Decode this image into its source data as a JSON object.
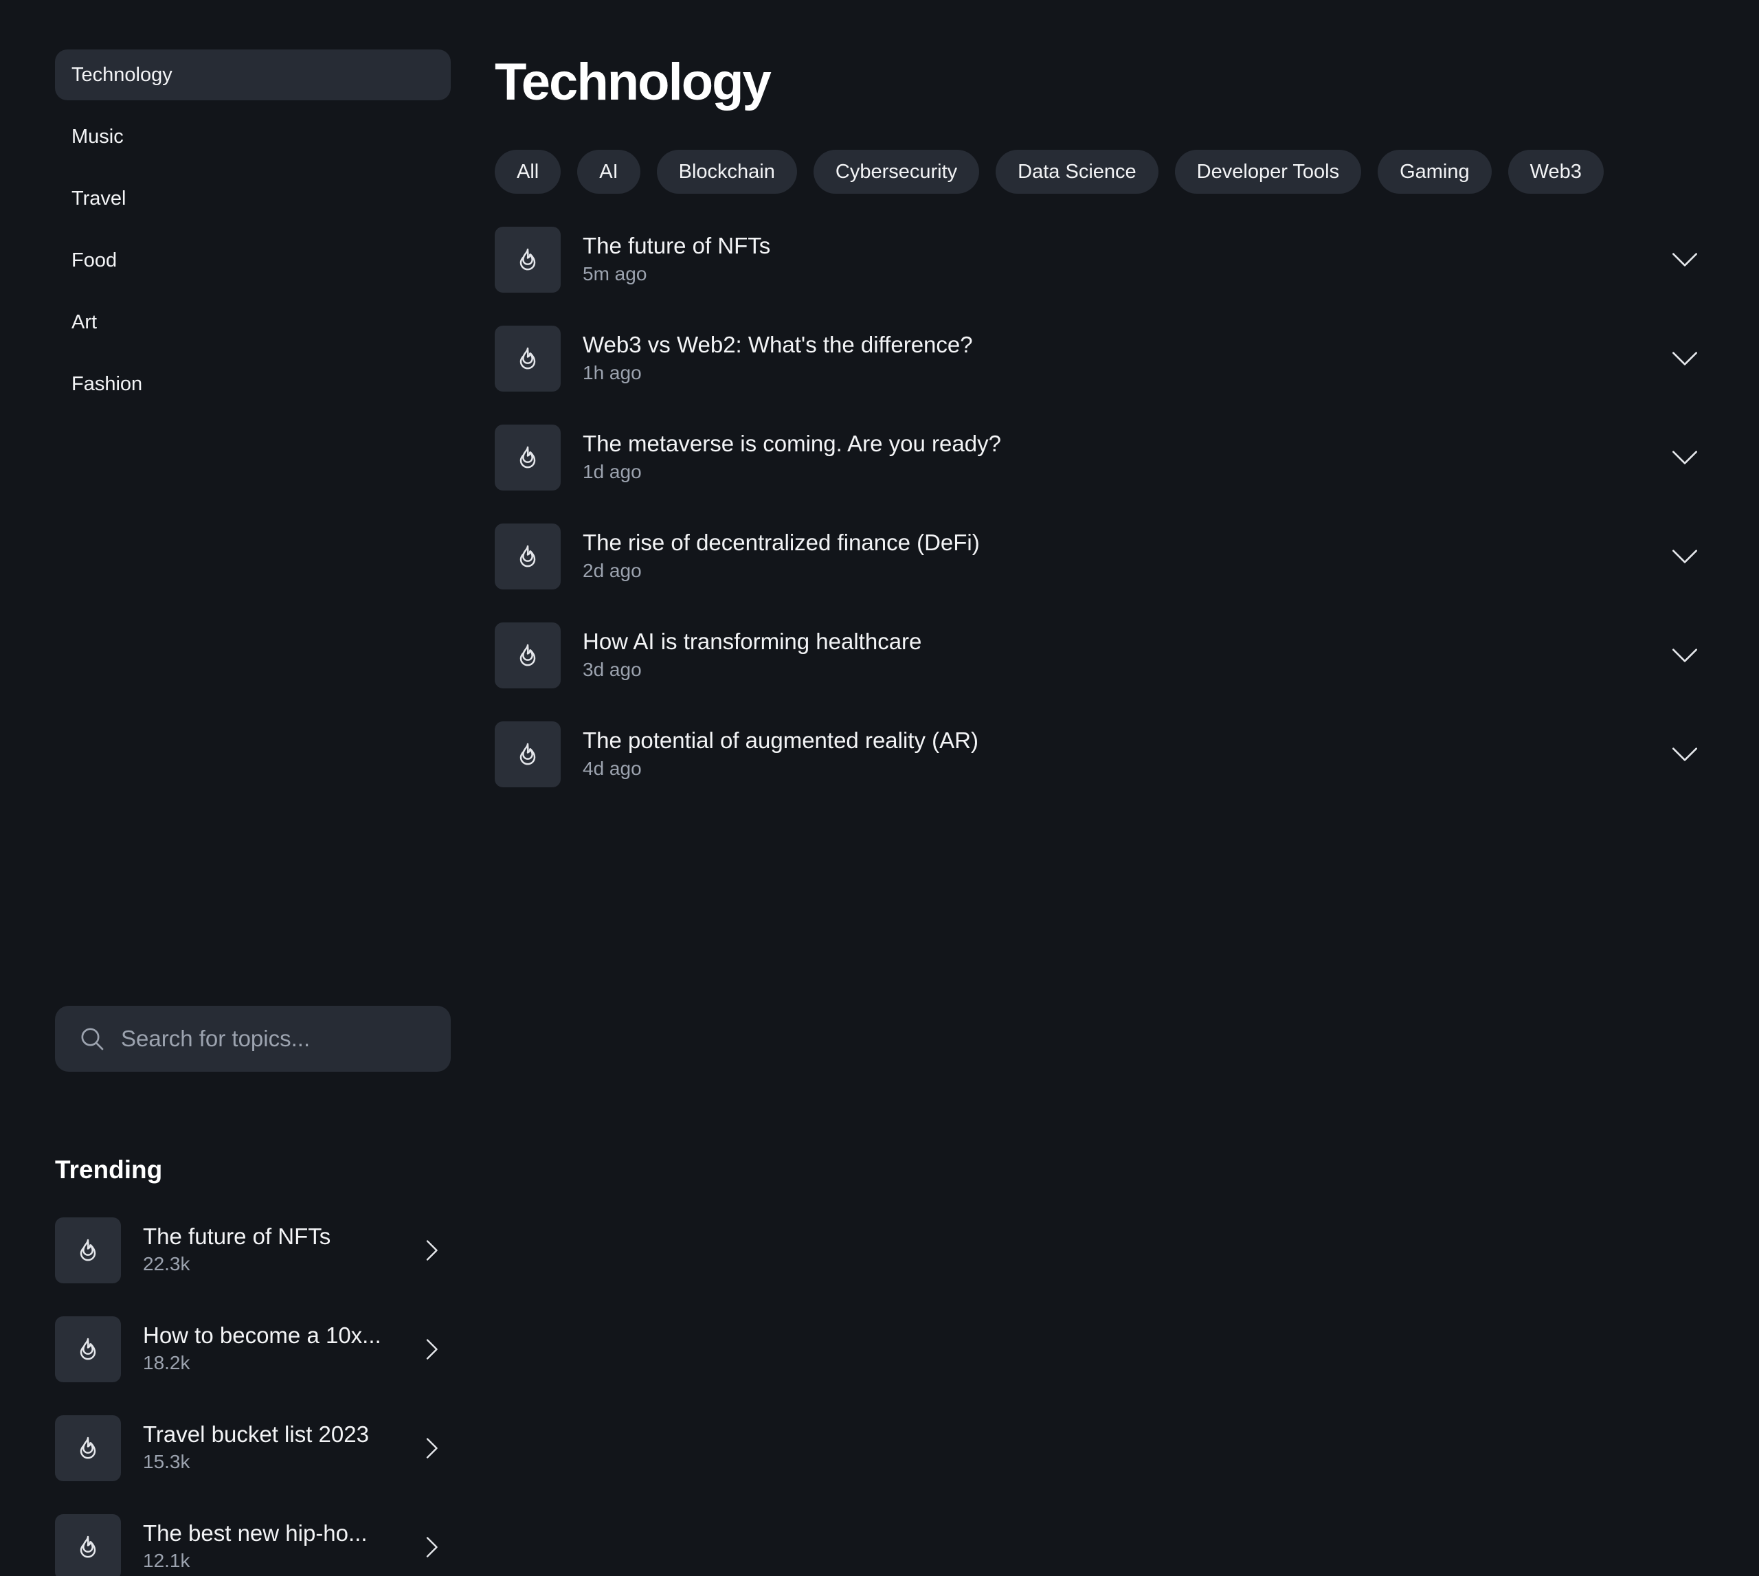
{
  "sidebar": {
    "nav": [
      {
        "label": "Technology",
        "active": true
      },
      {
        "label": "Music",
        "active": false
      },
      {
        "label": "Travel",
        "active": false
      },
      {
        "label": "Food",
        "active": false
      },
      {
        "label": "Art",
        "active": false
      },
      {
        "label": "Fashion",
        "active": false
      }
    ],
    "search": {
      "placeholder": "Search for topics...",
      "icon": "search-icon"
    },
    "trending": {
      "title": "Trending",
      "items": [
        {
          "title": "The future of NFTs",
          "count": "22.3k",
          "icon": "flame-icon"
        },
        {
          "title": "How to become a 10x...",
          "count": "18.2k",
          "icon": "flame-icon"
        },
        {
          "title": "Travel bucket list 2023",
          "count": "15.3k",
          "icon": "flame-icon"
        },
        {
          "title": "The best new hip-ho...",
          "count": "12.1k",
          "icon": "flame-icon"
        }
      ]
    }
  },
  "main": {
    "title": "Technology",
    "filters": [
      "All",
      "AI",
      "Blockchain",
      "Cybersecurity",
      "Data Science",
      "Developer Tools",
      "Gaming",
      "Web3"
    ],
    "feed": [
      {
        "title": "The future of NFTs",
        "time": "5m ago",
        "icon": "flame-icon"
      },
      {
        "title": "Web3 vs Web2: What's the difference?",
        "time": "1h ago",
        "icon": "flame-icon"
      },
      {
        "title": "The metaverse is coming. Are you ready?",
        "time": "1d ago",
        "icon": "flame-icon"
      },
      {
        "title": "The rise of decentralized finance (DeFi)",
        "time": "2d ago",
        "icon": "flame-icon"
      },
      {
        "title": "How AI is transforming healthcare",
        "time": "3d ago",
        "icon": "flame-icon"
      },
      {
        "title": "The potential of augmented reality (AR)",
        "time": "4d ago",
        "icon": "flame-icon"
      }
    ]
  },
  "colors": {
    "background": "#12151a",
    "surface": "#272c35",
    "text": "#f3f4f6",
    "muted": "#9ca3af"
  }
}
